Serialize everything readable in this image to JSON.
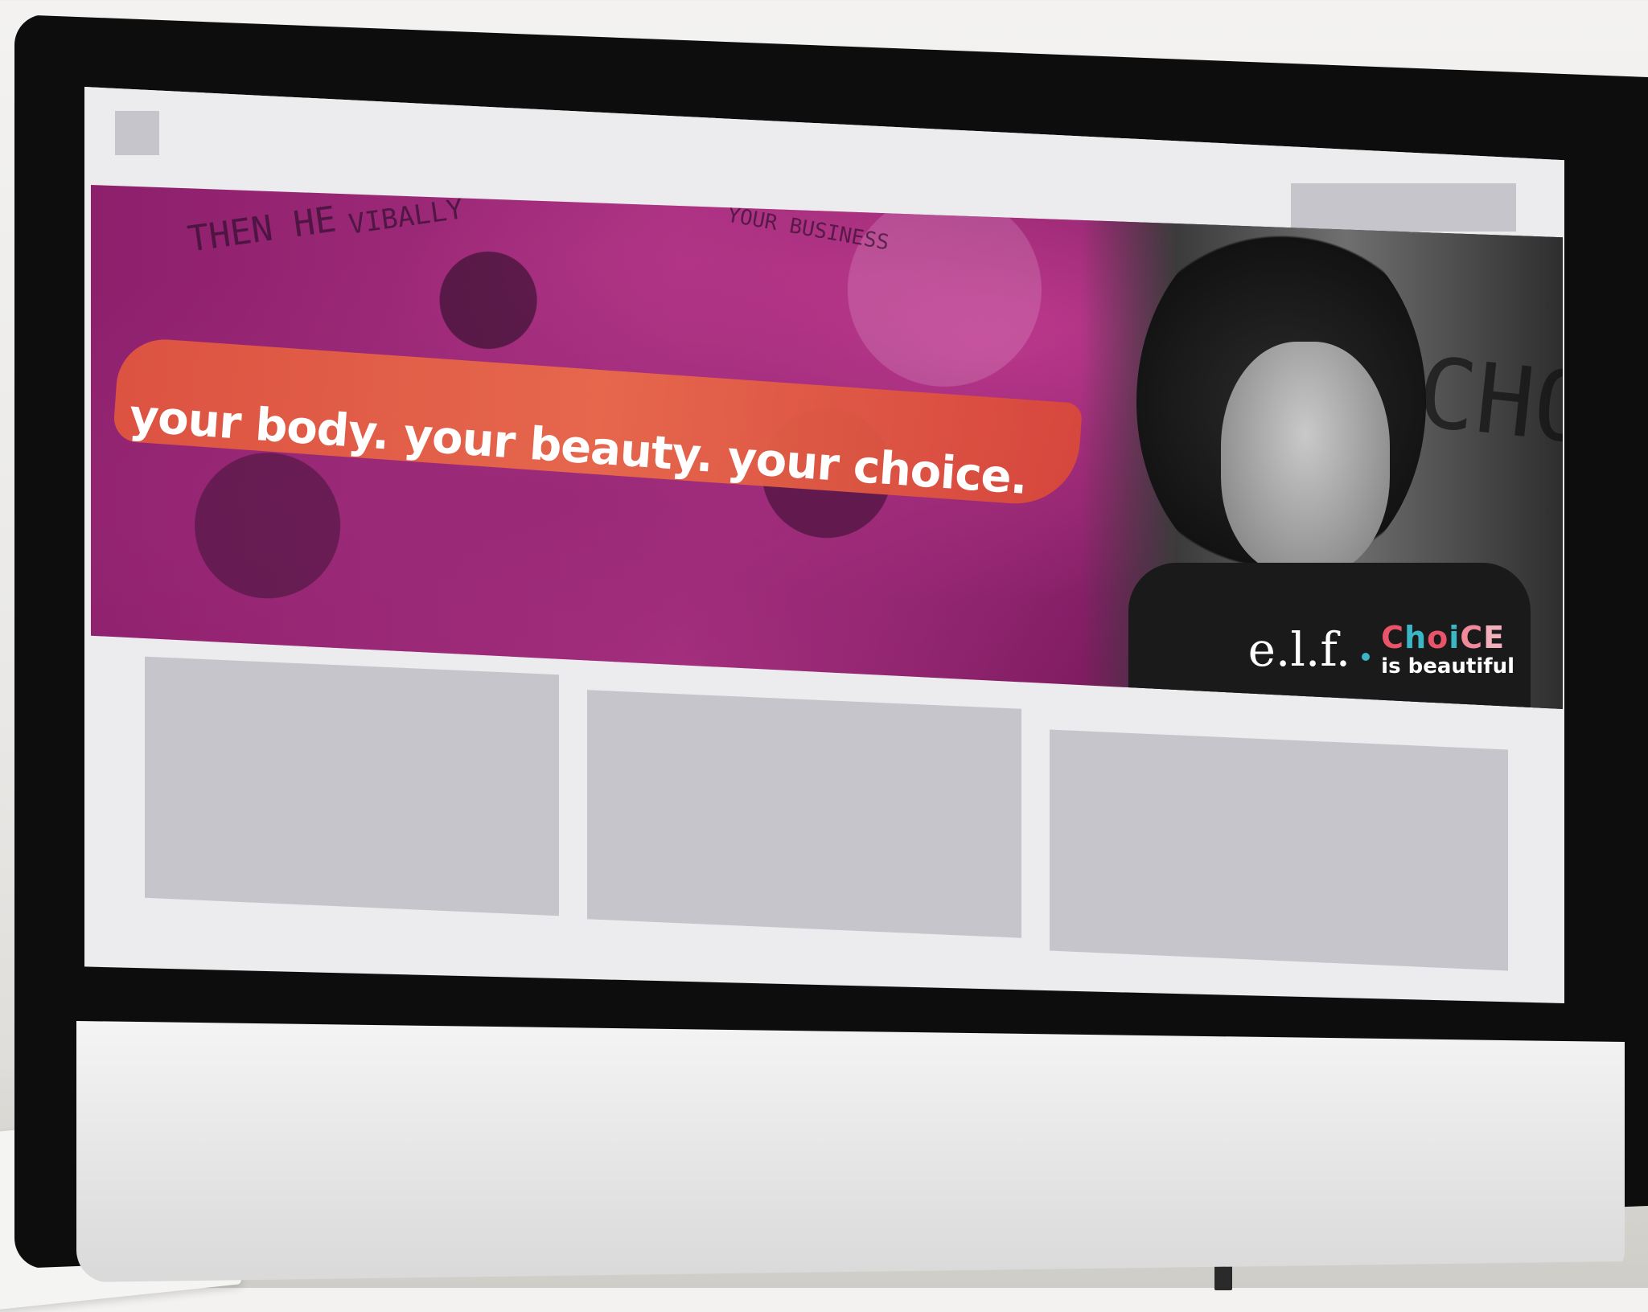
{
  "hero": {
    "tagline": "your body. your beauty. your choice.",
    "signs": [
      "THEN HE",
      "VIBALLY",
      "YOUR BUSINESS",
      "CHO"
    ],
    "brand": {
      "elf": "e.l.f.",
      "choice_letters": [
        "C",
        "h",
        "o",
        "i",
        "C",
        "E"
      ],
      "subline": "is beautiful"
    }
  },
  "colors": {
    "hero_magenta": "#9a2a78",
    "stroke_coral": "#e0553f",
    "accent_teal": "#3bb6c4",
    "accent_pink": "#e9546b",
    "placeholder_gray": "#c5c5cb"
  }
}
